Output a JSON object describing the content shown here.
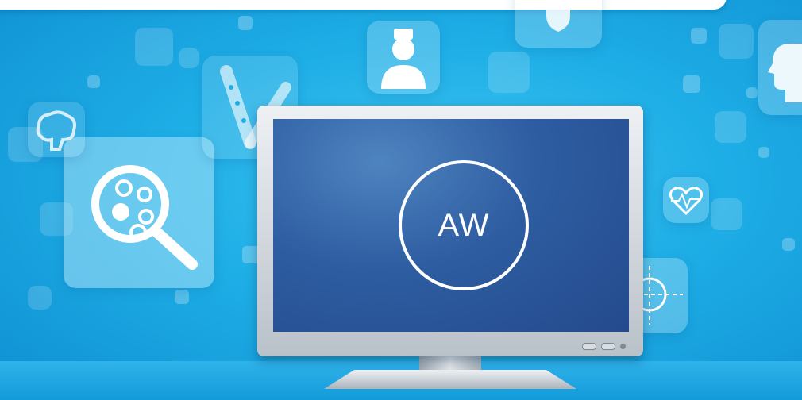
{
  "monitor": {
    "logo_text": "AW"
  },
  "icons": [
    "magnifier-cells-icon",
    "nurse-icon",
    "shield-icon",
    "head-profile-icon",
    "heart-pulse-icon",
    "bone-icon",
    "brain-icon",
    "hand-target-icon"
  ],
  "colors": {
    "background": "#1eaee6",
    "screen": "#2e5da1",
    "bezel": "#d5dbe0",
    "glyph": "#ffffff"
  }
}
